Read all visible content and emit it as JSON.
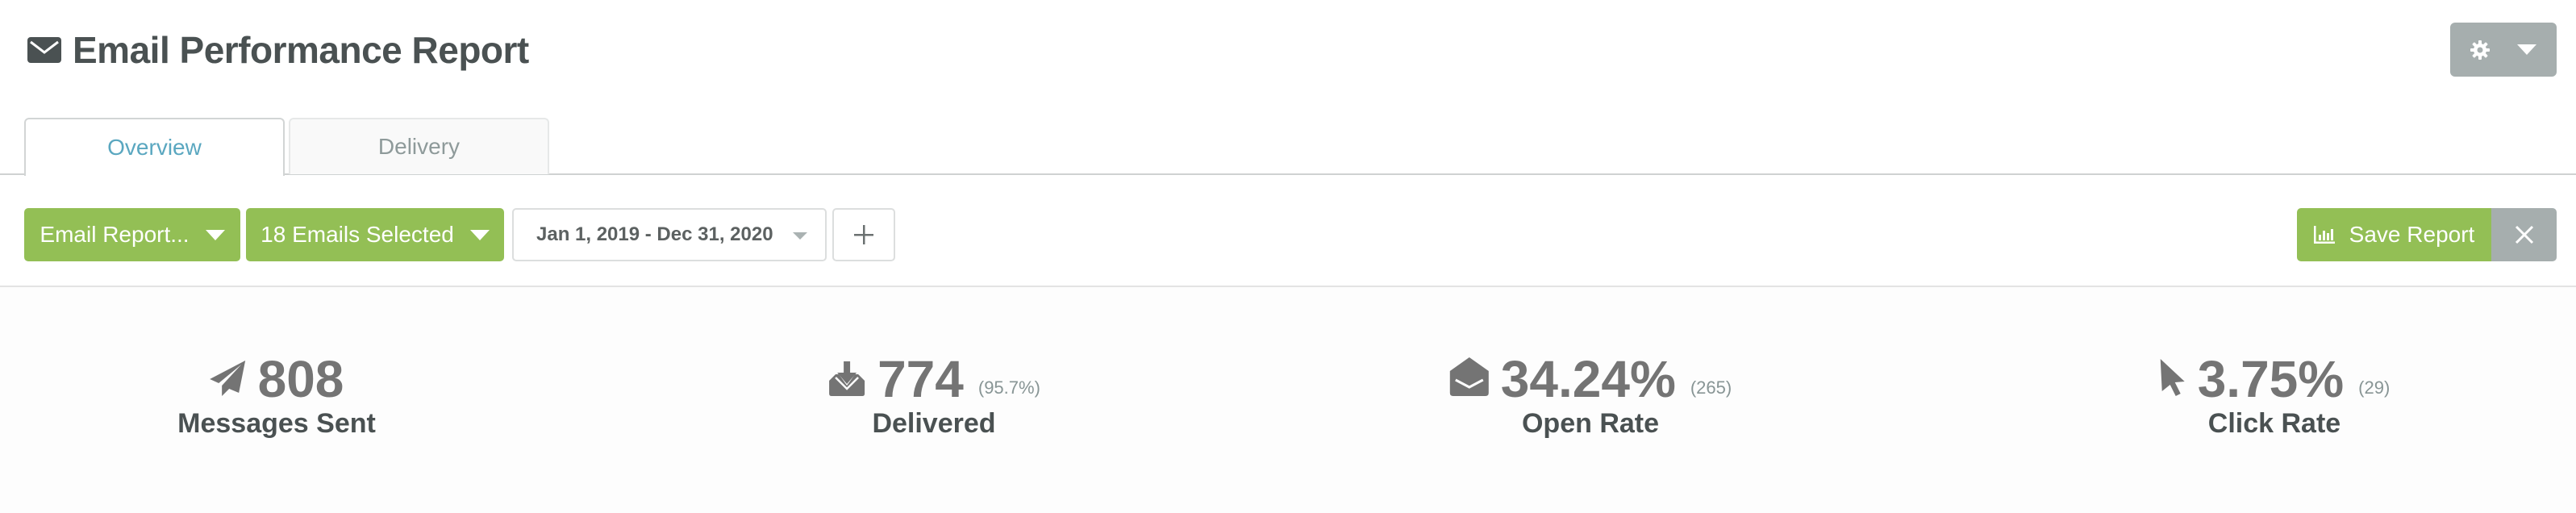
{
  "header": {
    "title": "Email Performance Report",
    "title_icon": "envelope-icon",
    "settings_button": {
      "icon": "gear-icon",
      "caret_icon": "caret-down-icon"
    }
  },
  "tabs": [
    {
      "label": "Overview",
      "active": true
    },
    {
      "label": "Delivery",
      "active": false
    }
  ],
  "toolbar": {
    "report_select": {
      "label": "Email Report...",
      "icon": "caret-down-icon"
    },
    "emails_select": {
      "label": "18 Emails Selected",
      "icon": "caret-down-icon"
    },
    "date_range": {
      "value": "Jan 1, 2019 - Dec 31, 2020",
      "icon": "caret-down-icon"
    },
    "add_button": {
      "icon": "plus-icon"
    },
    "save_button": {
      "label": "Save Report",
      "icon": "bar-chart-icon"
    },
    "close_button": {
      "icon": "close-icon"
    }
  },
  "stats": [
    {
      "icon": "paper-plane-icon",
      "value": "808",
      "sub": "",
      "label": "Messages Sent"
    },
    {
      "icon": "inbox-download-icon",
      "value": "774",
      "sub": "(95.7%)",
      "label": "Delivered"
    },
    {
      "icon": "envelope-open-icon",
      "value": "34.24%",
      "sub": "(265)",
      "label": "Open Rate"
    },
    {
      "icon": "mouse-pointer-icon",
      "value": "3.75%",
      "sub": "(29)",
      "label": "Click Rate"
    }
  ],
  "colors": {
    "primary_green": "#93bf55",
    "neutral_gray": "#a6aeae",
    "active_tab_text": "#5aa7c0",
    "title_text": "#4a5152",
    "stat_number": "#747474"
  }
}
